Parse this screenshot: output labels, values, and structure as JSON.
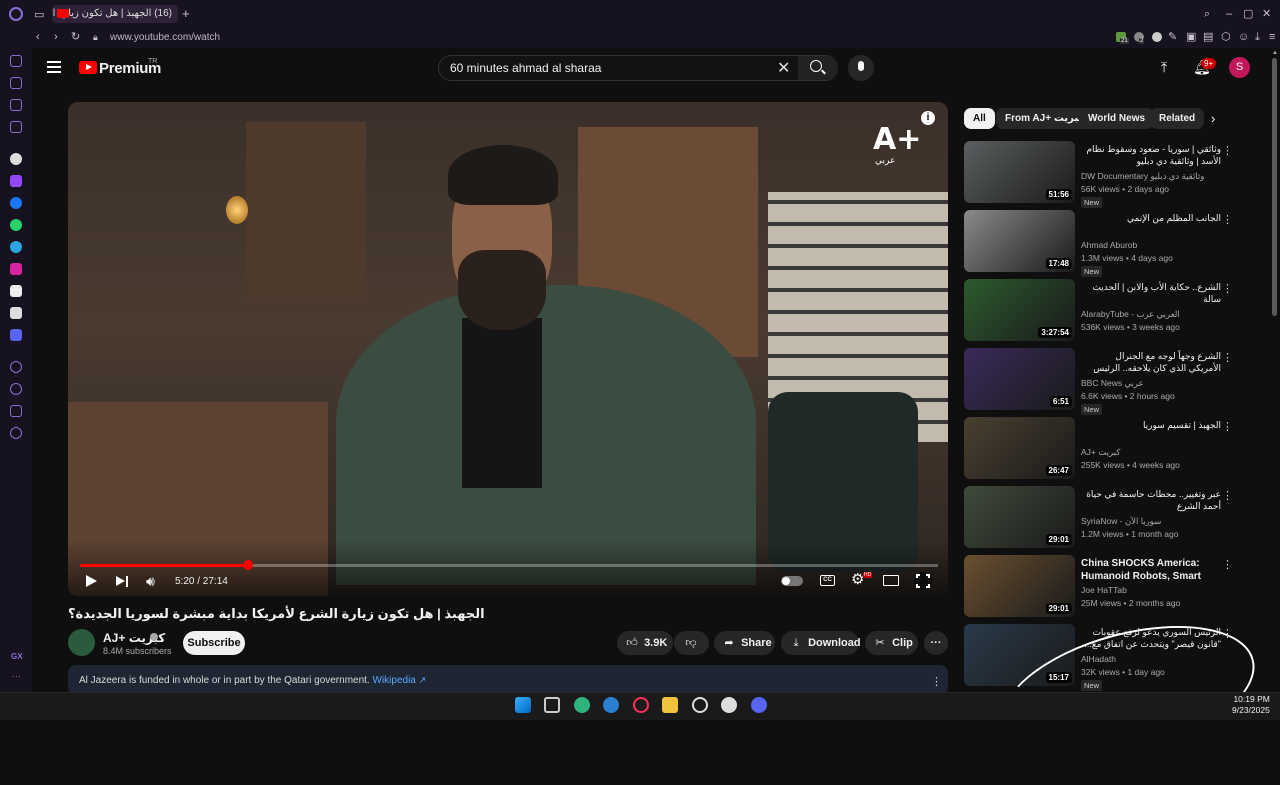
{
  "browser": {
    "tab_title": "(16) الجهبذ | هل تكون زيارة الـ",
    "url": "www.youtube.com/watch",
    "sidebar_label": "GX",
    "extension_badges": [
      "21",
      "2"
    ]
  },
  "header": {
    "logo_text": "Premium",
    "logo_region": "TR",
    "search_value": "60 minutes ahmad al sharaa",
    "notifications_badge": "9+",
    "avatar_letter": "S"
  },
  "player": {
    "watermark": "A+",
    "watermark_sub": "عربي",
    "current_time": "5:20 / 27:14",
    "progress_fraction": 0.1954,
    "cc_label": "CC",
    "quality_badge": "HD",
    "info_label": "i"
  },
  "video": {
    "title": "الجهبذ | هل تكون زيارة الشرع لأمريكا بداية مبشرة لسوريا الجديدة؟",
    "channel": "AJ+ كبريت",
    "subscribers": "8.4M subscribers",
    "subscribe_label": "Subscribe",
    "likes": "3.9K",
    "share_label": "Share",
    "download_label": "Download",
    "clip_label": "Clip",
    "notice_text": "Al Jazeera is funded in whole or in part by the Qatari government.",
    "notice_link": "Wikipedia"
  },
  "chips": [
    "All",
    "From AJ+ كبريت",
    "World News",
    "Related"
  ],
  "recommendations": [
    {
      "title": "وثائقي | سوريا - صعود وسقوط نظام الأسد | وثائقية دي دبليو",
      "channel": "DW Documentary وثائقية دي دبليو",
      "meta": "56K views • 2 days ago",
      "badge": "New",
      "duration": "51:56",
      "rtl": true,
      "thumb": "#5b5f60"
    },
    {
      "title": "الجانب المظلم من الإنمي",
      "channel": "Ahmad Aburob",
      "meta": "1.3M views • 4 days ago",
      "badge": "New",
      "duration": "17:48",
      "rtl": true,
      "thumb": "#8a8a8a"
    },
    {
      "title": "الشرع.. حكاية الأب والابن | الحديث سالة",
      "channel": "AlarabyTube - العربي عرب",
      "meta": "536K views • 3 weeks ago",
      "badge": "",
      "duration": "3:27:54",
      "rtl": true,
      "thumb": "#2c5a2e"
    },
    {
      "title": "الشرع وجهاً لوجه مع الجنرال الأمريكي الذي كان يلاحقه.. الرئيس السوري يجيبه كيف ...",
      "channel": "BBC News عربي",
      "meta": "6.6K views • 2 hours ago",
      "badge": "New",
      "duration": "6:51",
      "rtl": true,
      "thumb": "#3a2a5a"
    },
    {
      "title": "الجهبذ | تقسيم سوريا",
      "channel": "AJ+ كبريت",
      "meta": "255K views • 4 weeks ago",
      "badge": "",
      "duration": "26:47",
      "rtl": true,
      "thumb": "#4a4030"
    },
    {
      "title": "عبر وتغيير.. محطات حاسمة في حياة أحمد الشرع",
      "channel": "SyriaNow - سوريا الآن",
      "meta": "1.2M views • 1 month ago",
      "badge": "",
      "duration": "29:01",
      "rtl": true,
      "thumb": "#3f4a3a"
    },
    {
      "title": "China SHOCKS America: Humanoid Robots, Smart Citie...",
      "channel": "Joe HaTTab",
      "meta": "25M views • 2 months ago",
      "badge": "",
      "duration": "29:01",
      "rtl": false,
      "thumb": "#6a5030"
    },
    {
      "title": "الرئيس السوري يدعو لرفع عقوبات \"قانون قيصر\" ويتحدث عن اتفاق مع...",
      "channel": "AlHadath",
      "meta": "32K views • 1 day ago",
      "badge": "New",
      "duration": "15:17",
      "rtl": true,
      "thumb": "#2a3a4a"
    }
  ],
  "taskbar": {
    "time": "10:19 PM",
    "date": "9/23/2025"
  }
}
